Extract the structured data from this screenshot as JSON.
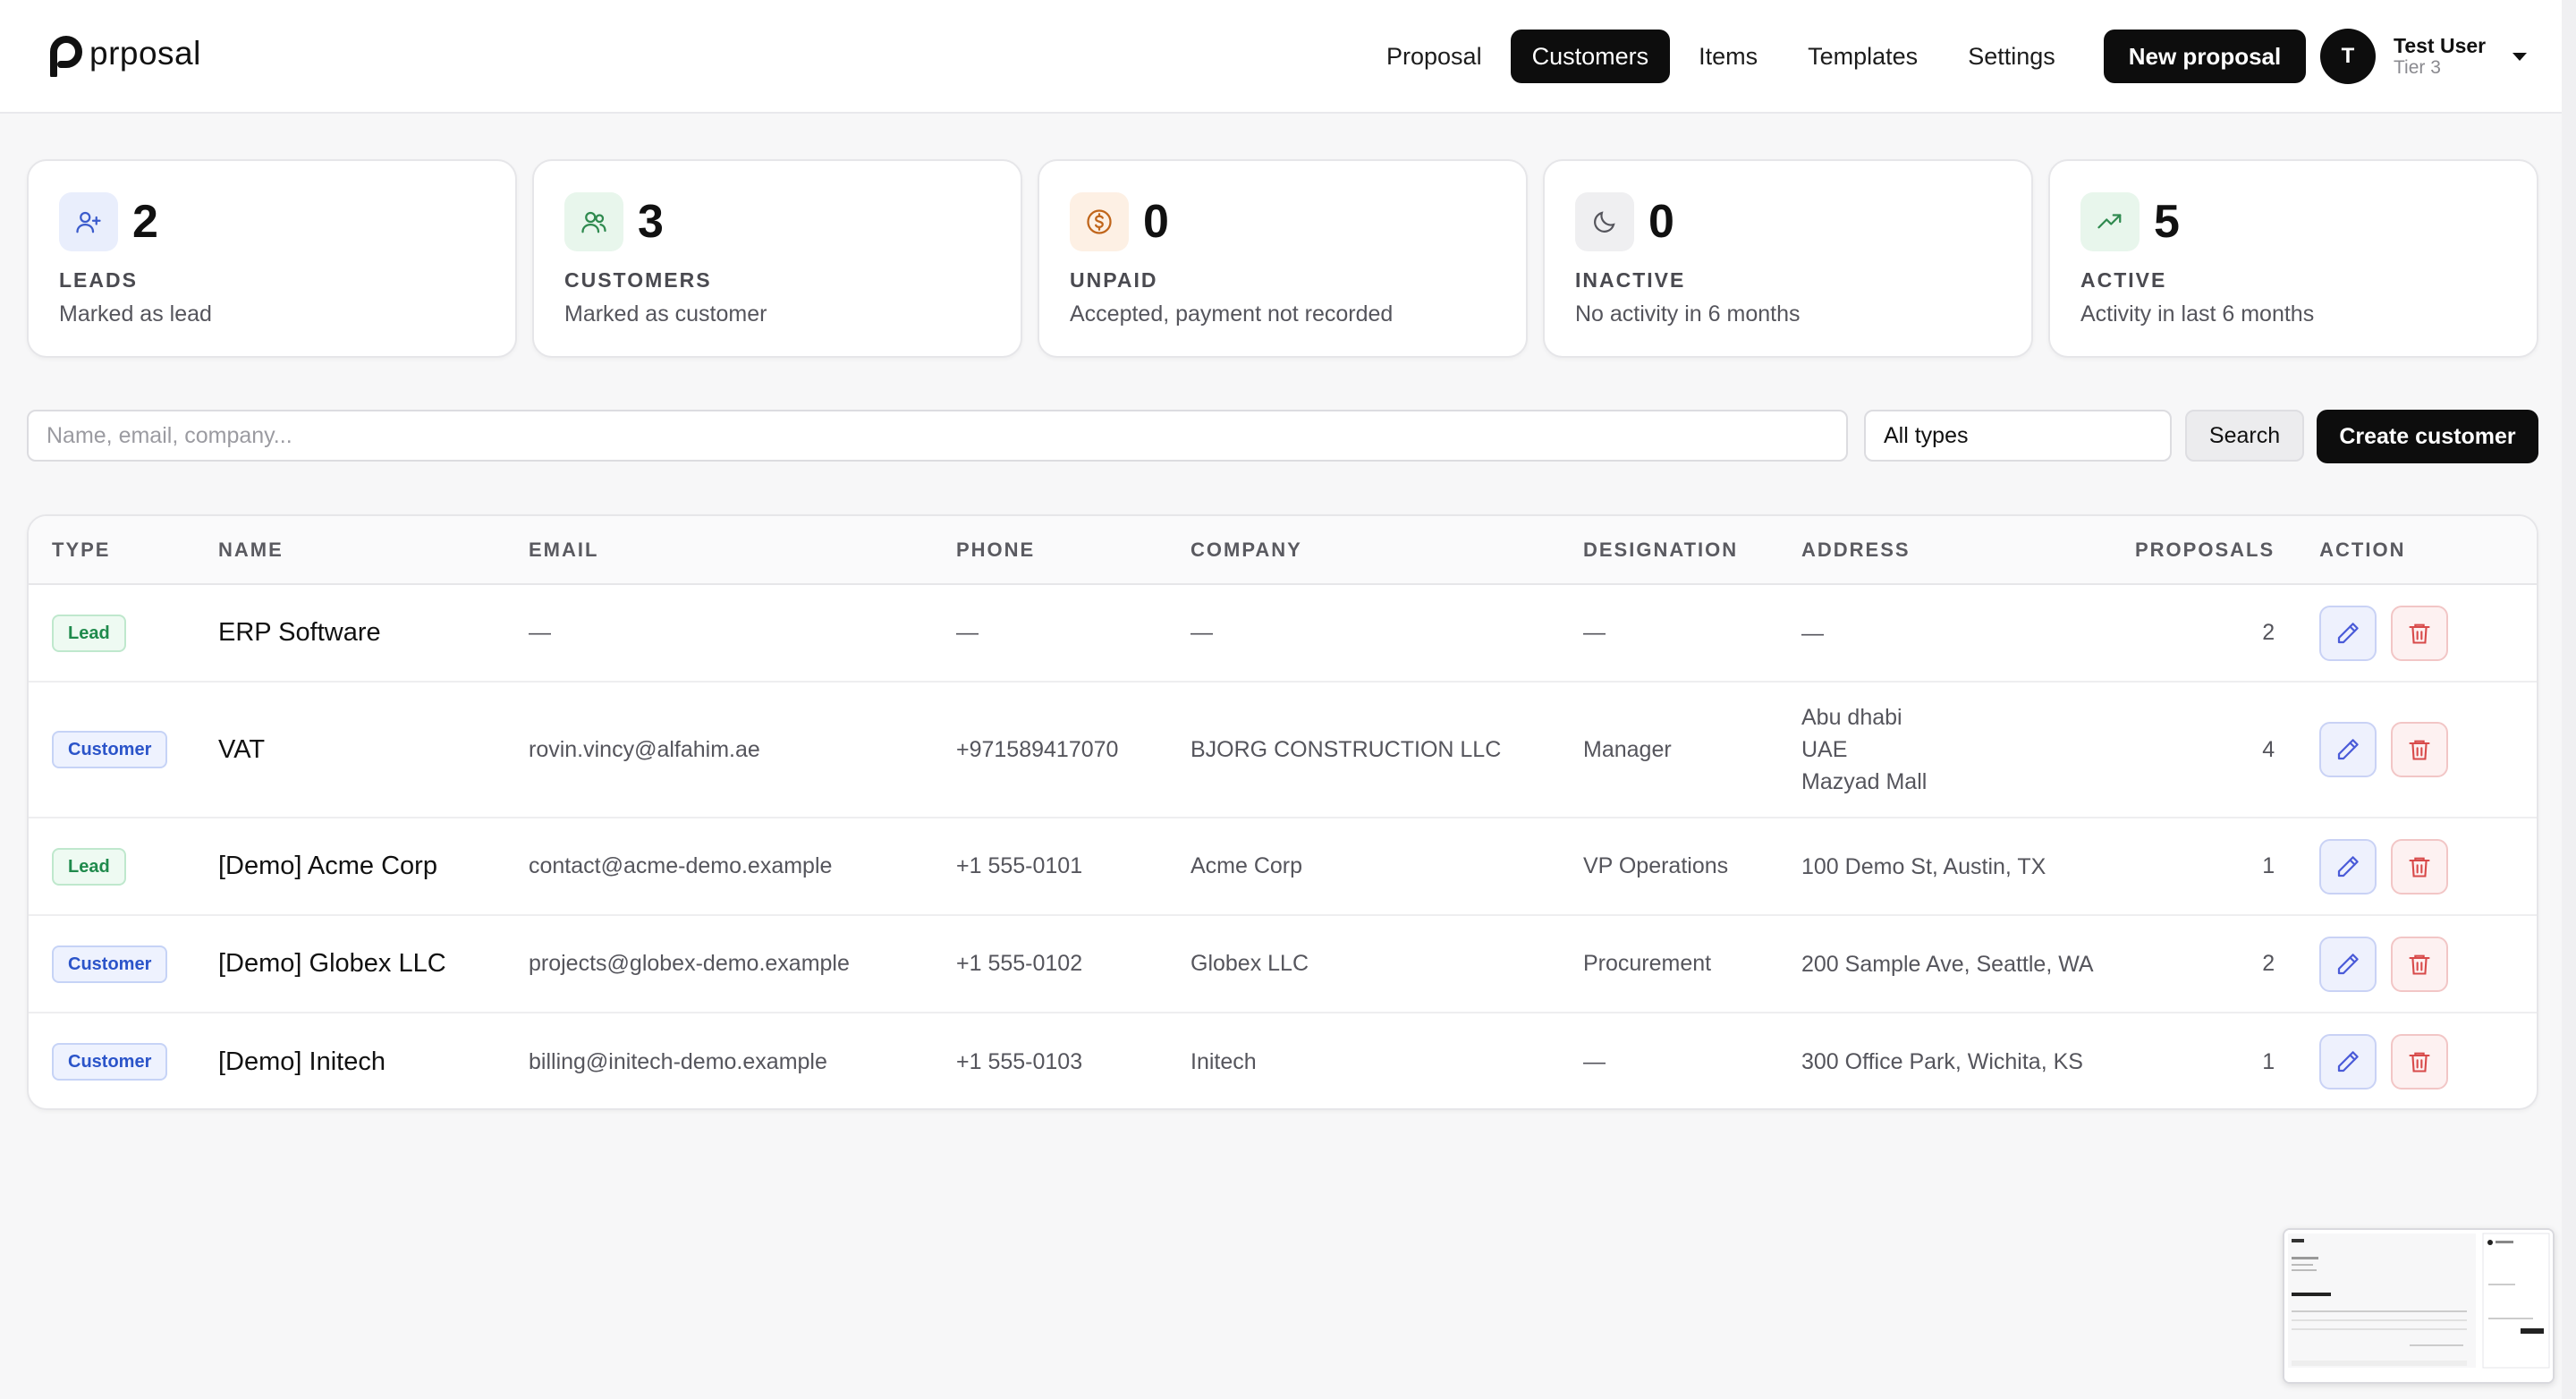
{
  "brand": {
    "name": "prposal"
  },
  "nav": {
    "items": [
      {
        "label": "Proposal",
        "active": false
      },
      {
        "label": "Customers",
        "active": true
      },
      {
        "label": "Items",
        "active": false
      },
      {
        "label": "Templates",
        "active": false
      },
      {
        "label": "Settings",
        "active": false
      }
    ],
    "new_proposal_label": "New proposal"
  },
  "user": {
    "initial": "T",
    "name": "Test User",
    "tier": "Tier 3"
  },
  "stats": [
    {
      "icon": "user-plus-icon",
      "value": "2",
      "label": "LEADS",
      "sub": "Marked as lead",
      "icon_bg": "#e9eefc",
      "icon_color": "#3b5bcc"
    },
    {
      "icon": "users-icon",
      "value": "3",
      "label": "CUSTOMERS",
      "sub": "Marked as customer",
      "icon_bg": "#e8f6ec",
      "icon_color": "#2f8a4f"
    },
    {
      "icon": "dollar-circle-icon",
      "value": "0",
      "label": "UNPAID",
      "sub": "Accepted, payment not recorded",
      "icon_bg": "#fdf0e4",
      "icon_color": "#c0651a"
    },
    {
      "icon": "moon-icon",
      "value": "0",
      "label": "INACTIVE",
      "sub": "No activity in 6 months",
      "icon_bg": "#efeff1",
      "icon_color": "#55555c"
    },
    {
      "icon": "trending-up-icon",
      "value": "5",
      "label": "ACTIVE",
      "sub": "Activity in last 6 months",
      "icon_bg": "#e8f6ec",
      "icon_color": "#2f8a4f"
    }
  ],
  "search": {
    "placeholder": "Name, email, company...",
    "value": "",
    "type_filter": "All types",
    "search_label": "Search",
    "create_label": "Create customer"
  },
  "table": {
    "columns": [
      "TYPE",
      "NAME",
      "EMAIL",
      "PHONE",
      "COMPANY",
      "DESIGNATION",
      "ADDRESS",
      "PROPOSALS",
      "ACTION"
    ],
    "rows": [
      {
        "type": "Lead",
        "name": "ERP Software",
        "email": "—",
        "phone": "—",
        "company": "—",
        "designation": "—",
        "address": [
          "—"
        ],
        "proposals": "2"
      },
      {
        "type": "Customer",
        "name": "VAT",
        "email": "rovin.vincy@alfahim.ae",
        "phone": "+971589417070",
        "company": "BJORG CONSTRUCTION LLC",
        "designation": "Manager",
        "address": [
          "Abu dhabi",
          "UAE",
          "Mazyad Mall"
        ],
        "proposals": "4"
      },
      {
        "type": "Lead",
        "name": "[Demo] Acme Corp",
        "email": "contact@acme-demo.example",
        "phone": "+1 555-0101",
        "company": "Acme Corp",
        "designation": "VP Operations",
        "address": [
          "100 Demo St, Austin, TX"
        ],
        "proposals": "1"
      },
      {
        "type": "Customer",
        "name": "[Demo] Globex LLC",
        "email": "projects@globex-demo.example",
        "phone": "+1 555-0102",
        "company": "Globex LLC",
        "designation": "Procurement",
        "address": [
          "200 Sample Ave, Seattle, WA"
        ],
        "proposals": "2"
      },
      {
        "type": "Customer",
        "name": "[Demo] Initech",
        "email": "billing@initech-demo.example",
        "phone": "+1 555-0103",
        "company": "Initech",
        "designation": "—",
        "address": [
          "300 Office Park, Wichita, KS"
        ],
        "proposals": "1"
      }
    ]
  },
  "colors": {
    "primary": "#0d0d0d",
    "lead_badge": "#1f8a4c",
    "customer_badge": "#2b54c9",
    "edit_icon": "#4a5bd8",
    "delete_icon": "#d84a4a"
  }
}
